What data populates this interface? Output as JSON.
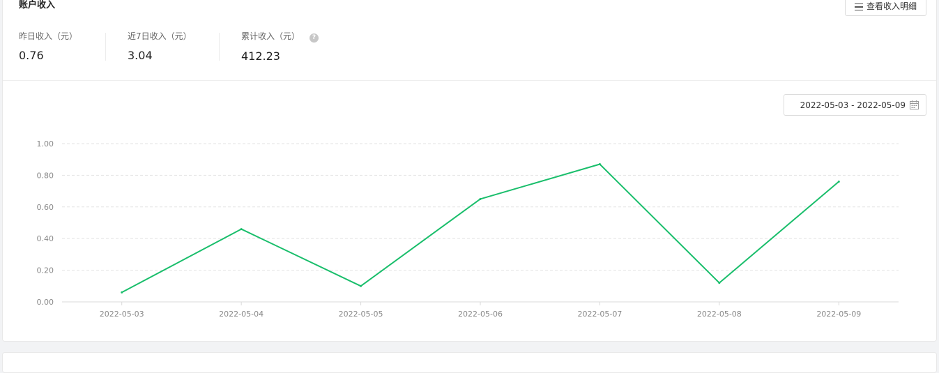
{
  "card": {
    "title": "账户收入",
    "detail_button": "查看收入明细",
    "stats": [
      {
        "label": "昨日收入（元）",
        "value": "0.76"
      },
      {
        "label": "近7日收入（元）",
        "value": "3.04"
      },
      {
        "label": "累计收入（元）",
        "value": "412.23"
      }
    ],
    "help_icon": "?",
    "date_range": "2022-05-03 - 2022-05-09"
  },
  "chart_data": {
    "type": "line",
    "x": [
      "2022-05-03",
      "2022-05-04",
      "2022-05-05",
      "2022-05-06",
      "2022-05-07",
      "2022-05-08",
      "2022-05-09"
    ],
    "series": [
      {
        "values": [
          0.06,
          0.46,
          0.1,
          0.65,
          0.87,
          0.12,
          0.76
        ],
        "color": "#19be6b"
      }
    ],
    "y_ticks": [
      "0.00",
      "0.20",
      "0.40",
      "0.60",
      "0.80",
      "1.00"
    ],
    "ylim": [
      0,
      1
    ],
    "grid": true,
    "title": "",
    "xlabel": "",
    "ylabel": ""
  }
}
